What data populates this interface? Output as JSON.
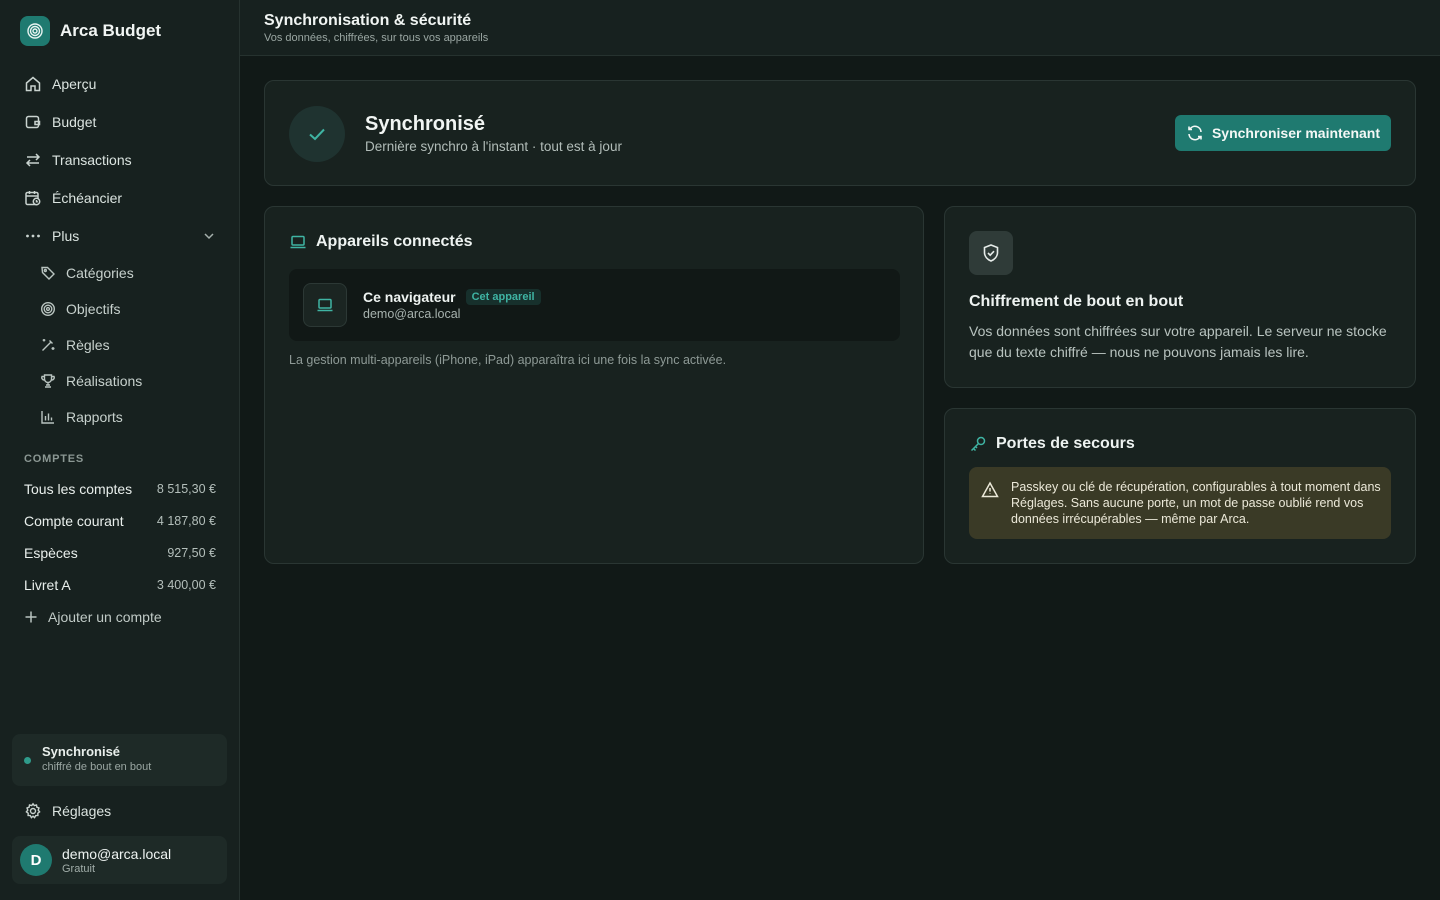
{
  "brand": {
    "name": "Arca Budget"
  },
  "nav": {
    "items": [
      {
        "label": "Aperçu",
        "icon": "home-icon"
      },
      {
        "label": "Budget",
        "icon": "wallet-icon"
      },
      {
        "label": "Transactions",
        "icon": "arrows-icon"
      },
      {
        "label": "Échéancier",
        "icon": "calendar-clock-icon"
      },
      {
        "label": "Plus",
        "icon": "more-icon"
      }
    ],
    "sub_items": [
      {
        "label": "Catégories",
        "icon": "tag-icon"
      },
      {
        "label": "Objectifs",
        "icon": "target-icon"
      },
      {
        "label": "Règles",
        "icon": "wand-icon"
      },
      {
        "label": "Réalisations",
        "icon": "trophy-icon"
      },
      {
        "label": "Rapports",
        "icon": "bar-chart-icon"
      }
    ]
  },
  "accounts": {
    "section_label": "COMPTES",
    "rows": [
      {
        "name": "Tous les comptes",
        "value": "8 515,30 €"
      },
      {
        "name": "Compte courant",
        "value": "4 187,80 €"
      },
      {
        "name": "Espèces",
        "value": "927,50 €"
      },
      {
        "name": "Livret A",
        "value": "3 400,00 €"
      }
    ],
    "add_label": "Ajouter un compte"
  },
  "sidebar_sync": {
    "title": "Synchronisé",
    "subtitle": "chiffré de bout en bout"
  },
  "settings": {
    "label": "Réglages"
  },
  "user": {
    "initial": "D",
    "email": "demo@arca.local",
    "plan": "Gratuit"
  },
  "header": {
    "title": "Synchronisation & sécurité",
    "subtitle": "Vos données, chiffrées, sur tous vos appareils"
  },
  "status": {
    "title": "Synchronisé",
    "subtitle": "Dernière synchro à l'instant · tout est à jour",
    "button_label": "Synchroniser maintenant"
  },
  "devices": {
    "title": "Appareils connectés",
    "device": {
      "name": "Ce navigateur",
      "badge": "Cet appareil",
      "email": "demo@arca.local"
    },
    "note": "La gestion multi-appareils (iPhone, iPad) apparaîtra ici une fois la sync activée."
  },
  "encryption": {
    "title": "Chiffrement de bout en bout",
    "text": "Vos données sont chiffrées sur votre appareil. Le serveur ne stocke que du texte chiffré — nous ne pouvons jamais les lire."
  },
  "rescue": {
    "title": "Portes de secours",
    "warning": "Passkey ou clé de récupération, configurables à tout moment dans Réglages. Sans aucune porte, un mot de passe oublié rend vos données irrécupérables — même par Arca."
  },
  "colors": {
    "accent": "#1f7a70",
    "accent_text": "#3fb4a3",
    "warning_bg": "#3a3a26"
  }
}
